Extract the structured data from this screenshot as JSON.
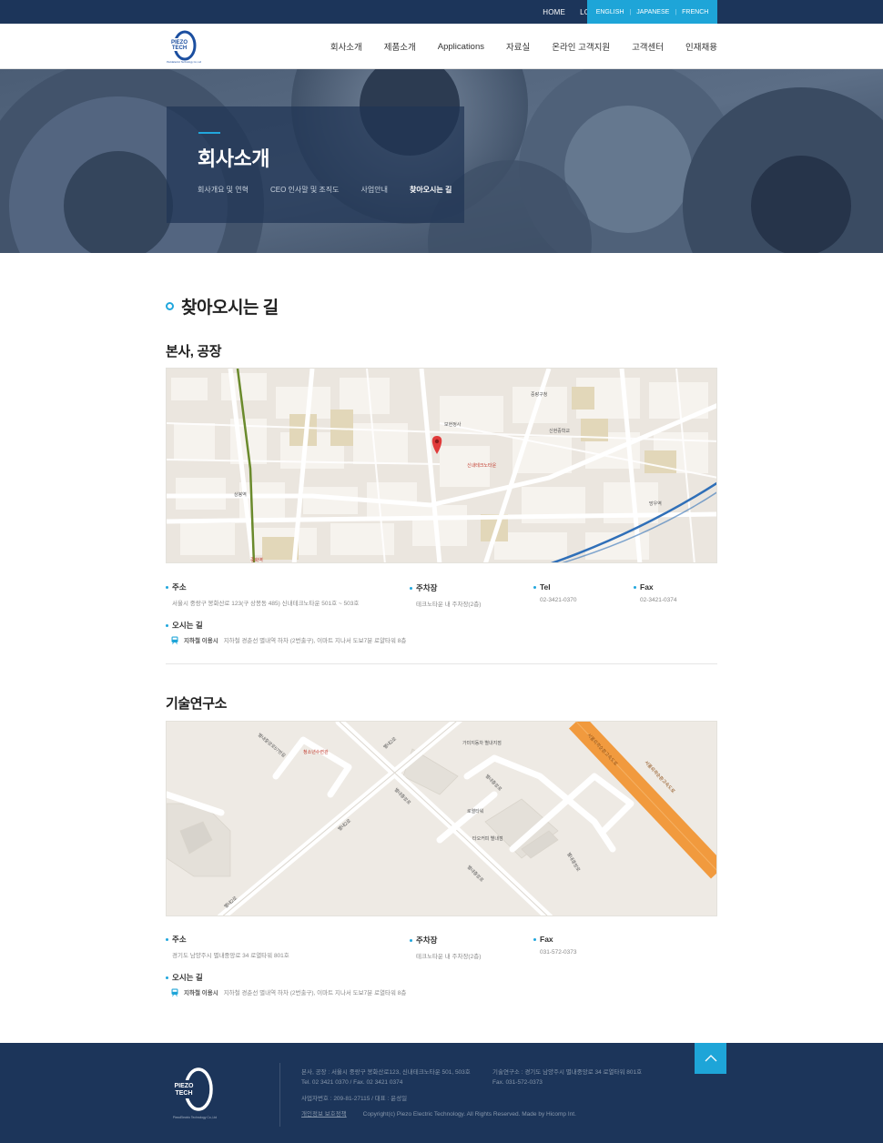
{
  "topbar": {
    "links": [
      "HOME",
      "LOGIN"
    ],
    "languages": [
      "ENGLISH",
      "JAPANESE",
      "FRENCH"
    ]
  },
  "header": {
    "logo_text": [
      "PIEZO",
      "TECH"
    ],
    "logo_sub": "PiezoElectric Technology Co.,Ltd",
    "nav": [
      "회사소개",
      "제품소개",
      "Applications",
      "자료실",
      "온라인 고객지원",
      "고객센터",
      "인재채용"
    ]
  },
  "hero": {
    "title": "회사소개",
    "subnav": [
      "회사개요 및 연혁",
      "CEO 인사말 및 조직도",
      "사업안내",
      "찾아오시는 길"
    ],
    "active_index": 3
  },
  "page_title": "찾아오시는 길",
  "hq": {
    "title": "본사, 공장",
    "address_label": "주소",
    "address": "서울시 중랑구 봉화산로 123(구 상봉동 485) 신내테크노타운 501호 ~ 503호",
    "parking_label": "주차장",
    "parking": "테크노타운 내 주차장(2층)",
    "tel_label": "Tel",
    "tel": "02-3421-0370",
    "fax_label": "Fax",
    "fax": "02-3421-0374",
    "route_label": "오시는 길",
    "route_type": "지하철 이용시",
    "route_desc": "지하철 경춘선 별내역 하차 (2번출구), 이마트 지나서 도보7분 로얄타워 8층",
    "map_labels": [
      "신내테크노타운",
      "보현정사",
      "중랑구청",
      "신현중학교",
      "망우역",
      "상봉역",
      "중화역"
    ]
  },
  "lab": {
    "title": "기술연구소",
    "address_label": "주소",
    "address": "경기도 남양주시 별내중앙로 34 로열타워 801호",
    "parking_label": "주차장",
    "parking": "테크노타운 내 주차장(2층)",
    "fax_label": "Fax",
    "fax": "031-572-0373",
    "route_label": "오시는 길",
    "route_type": "지하철 이용시",
    "route_desc": "지하철 경춘선 별내역 하차 (2번출구), 이마트 지나서 도보7분 로열타워 8층",
    "map_labels": [
      "별내중앙로",
      "별내2로",
      "별내중앙로",
      "별내중앙로",
      "서울외곽순환고속도로",
      "서울외곽순환고속도로",
      "로열타워",
      "타오커피 별내점",
      "청소년수련관",
      "별내중앙로57번길",
      "가미지동차 별내지점"
    ]
  },
  "footer": {
    "hq_line": "본사, 공장 : 서울시 중랑구 봉화산로123, 신내테크노타운 501, 503호",
    "hq_tel": "Tel. 02 3421 0370  /  Fax. 02 3421 0374",
    "lab_line": "기술연구소 : 경기도 남양주시 별내중앙로 34 로열타워 801호",
    "lab_fax": "Fax. 031-572-0373",
    "biz": "사업자번호 : 209-81-27115  /  대표 : 윤성일",
    "privacy": "개인정보 보호정책",
    "copyright": "Copyright(c) Piezo Electric Technology. All Rights Reserved. Made by Hicomp Int.",
    "top_icon": "chevron-up-icon"
  },
  "colors": {
    "navy": "#1c355a",
    "accent": "#1ea5d8",
    "highway": "#f19a3e"
  }
}
